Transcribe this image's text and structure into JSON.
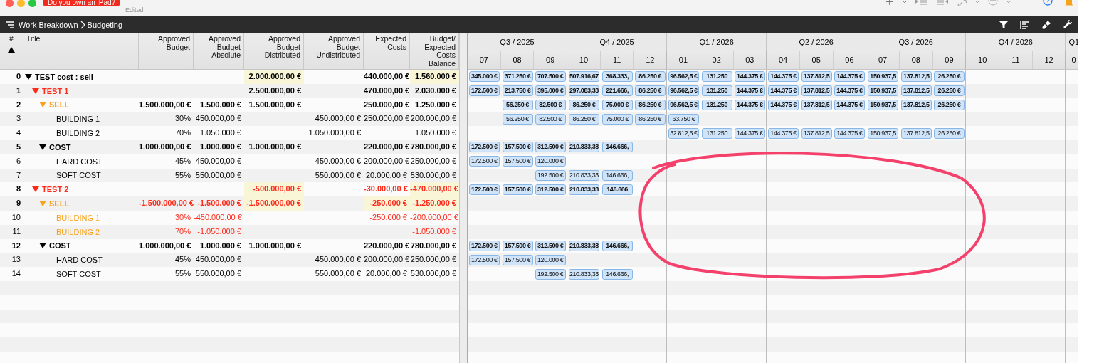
{
  "titlebar": {
    "badge": "Do you own an iPad?",
    "status": "Edited"
  },
  "breadcrumb": [
    "Work Breakdown",
    "Budgeting"
  ],
  "columns": [
    "#",
    "Title",
    "Approved Budget",
    "Approved Budget Absolute",
    "Approved Budget Distributed",
    "Approved Budget Undistributed",
    "Expected Costs",
    "Budget/ Expected Costs Balance"
  ],
  "timeline": {
    "quarters": [
      {
        "label": "Q3 / 2025",
        "months": [
          "07",
          "08",
          "09"
        ]
      },
      {
        "label": "Q4 / 2025",
        "months": [
          "10",
          "11",
          "12"
        ]
      },
      {
        "label": "Q1 / 2026",
        "months": [
          "01",
          "02",
          "03"
        ]
      },
      {
        "label": "Q2 / 2026",
        "months": [
          "04",
          "05",
          "06"
        ]
      },
      {
        "label": "Q3 / 2026",
        "months": [
          "07",
          "08",
          "09"
        ]
      },
      {
        "label": "Q4 / 2026",
        "months": [
          "10",
          "11",
          "12"
        ]
      },
      {
        "label": "Q1",
        "months": [
          "0"
        ]
      }
    ]
  },
  "rows": [
    {
      "number": "0",
      "title": "TEST cost : sell",
      "color": "#000000",
      "expanded": true,
      "negative": false,
      "approved_budget_distributed": {
        "text": "2.000.000,00 €",
        "highlighted": true
      },
      "expected_costs": {
        "text": "440.000,00 €",
        "highlighted": false
      },
      "balance": {
        "text": "1.560.000 €",
        "highlighted": true
      },
      "bars": [
        {
          "kind": "amount",
          "text": "345.000 €"
        },
        {
          "kind": "amount",
          "text": "371.250 €"
        },
        {
          "kind": "amount",
          "text": "707.500 €"
        },
        {
          "kind": "amount",
          "text": "507.916,67"
        },
        {
          "kind": "amount",
          "text": "368.333,"
        },
        {
          "kind": "amount",
          "text": "86.250 €"
        },
        {
          "kind": "amount",
          "text": "96.562,5 €"
        },
        {
          "kind": "amount",
          "text": "131.250"
        },
        {
          "kind": "amount",
          "text": "144.375 €"
        },
        {
          "kind": "amount",
          "text": "144.375 €"
        },
        {
          "kind": "amount",
          "text": "137.812,5"
        },
        {
          "kind": "amount",
          "text": "144.375 €"
        },
        {
          "kind": "amount",
          "text": "150.937,5"
        },
        {
          "kind": "amount",
          "text": "137.812,5"
        },
        {
          "kind": "amount",
          "text": "26.250 €"
        }
      ],
      "children": [
        {
          "number": "1",
          "title": "TEST 1",
          "color": "#ff2a1a",
          "expanded": true,
          "negative": false,
          "approved_budget_distributed": {
            "text": "2.500.000,00 €",
            "highlighted": false
          },
          "expected_costs": {
            "text": "470.000,00 €",
            "highlighted": false
          },
          "balance": {
            "text": "2.030.000 €",
            "highlighted": false
          },
          "bars": [
            {
              "kind": "amount",
              "text": "172.500 €"
            },
            {
              "kind": "amount",
              "text": "213.750 €"
            },
            {
              "kind": "amount",
              "text": "395.000 €"
            },
            {
              "kind": "amount",
              "text": "297.083,33"
            },
            {
              "kind": "amount",
              "text": "221.666,"
            },
            {
              "kind": "amount",
              "text": "86.250 €"
            },
            {
              "kind": "amount",
              "text": "96.562,5 €"
            },
            {
              "kind": "amount",
              "text": "131.250"
            },
            {
              "kind": "amount",
              "text": "144.375 €"
            },
            {
              "kind": "amount",
              "text": "144.375 €"
            },
            {
              "kind": "amount",
              "text": "137.812,5"
            },
            {
              "kind": "amount",
              "text": "144.375 €"
            },
            {
              "kind": "amount",
              "text": "150.937,5"
            },
            {
              "kind": "amount",
              "text": "137.812,5"
            },
            {
              "kind": "amount",
              "text": "26.250 €"
            }
          ],
          "children": [
            {
              "number": "2",
              "title": "SELL",
              "color": "#f9a11b",
              "expanded": true,
              "negative": false,
              "approved_budget": {
                "text": "1.500.000,00 €",
                "highlighted": false
              },
              "approved_budget_absolute": {
                "text": "1.500.000 €",
                "highlighted": false
              },
              "approved_budget_distributed": {
                "text": "1.500.000,00 €",
                "highlighted": false
              },
              "expected_costs": {
                "text": "250.000,00 €",
                "highlighted": false
              },
              "balance": {
                "text": "1.250.000 €",
                "highlighted": false
              },
              "bars": [
                {
                  "kind": "gap"
                },
                {
                  "kind": "amount",
                  "text": "56.250 €"
                },
                {
                  "kind": "amount",
                  "text": "82.500 €"
                },
                {
                  "kind": "amount",
                  "text": "86.250 €"
                },
                {
                  "kind": "amount",
                  "text": "75.000 €"
                },
                {
                  "kind": "amount",
                  "text": "86.250 €"
                },
                {
                  "kind": "amount",
                  "text": "96.562,5 €"
                },
                {
                  "kind": "amount",
                  "text": "131.250"
                },
                {
                  "kind": "amount",
                  "text": "144.375 €"
                },
                {
                  "kind": "amount",
                  "text": "144.375 €"
                },
                {
                  "kind": "amount",
                  "text": "137.812,5"
                },
                {
                  "kind": "amount",
                  "text": "144.375 €"
                },
                {
                  "kind": "amount",
                  "text": "150.937,5"
                },
                {
                  "kind": "amount",
                  "text": "137.812,5"
                },
                {
                  "kind": "amount",
                  "text": "26.250 €"
                }
              ],
              "children": [
                {
                  "number": "3",
                  "title": "BUILDING 1",
                  "color": "#000000",
                  "negative": false,
                  "approved_budget": {
                    "text": "30%",
                    "highlighted": false
                  },
                  "approved_budget_absolute": {
                    "text": "450.000,00 €",
                    "highlighted": false
                  },
                  "approved_budget_undistributed": {
                    "text": "450.000,00 €",
                    "highlighted": false
                  },
                  "expected_costs": {
                    "text": "250.000,00 €",
                    "highlighted": false
                  },
                  "balance": {
                    "text": "200.000,00 €",
                    "highlighted": false
                  },
                  "bars": [
                    {
                      "kind": "gap"
                    },
                    {
                      "kind": "amount",
                      "text": "56.250 €"
                    },
                    {
                      "kind": "amount",
                      "text": "82.500 €"
                    },
                    {
                      "kind": "amount",
                      "text": "86.250 €"
                    },
                    {
                      "kind": "amount",
                      "text": "75.000 €"
                    },
                    {
                      "kind": "amount",
                      "text": "86.250 €"
                    },
                    {
                      "kind": "amount",
                      "text": "63.750 €"
                    }
                  ]
                },
                {
                  "number": "4",
                  "title": "BUILDING 2",
                  "color": "#000000",
                  "negative": false,
                  "approved_budget": {
                    "text": "70%",
                    "highlighted": false
                  },
                  "approved_budget_absolute": {
                    "text": "1.050.000 €",
                    "highlighted": false
                  },
                  "approved_budget_undistributed": {
                    "text": "1.050.000,00 €",
                    "highlighted": false
                  },
                  "balance": {
                    "text": "1.050.000 €",
                    "highlighted": false
                  },
                  "bars": [
                    {
                      "kind": "gap"
                    },
                    {
                      "kind": "gap"
                    },
                    {
                      "kind": "gap"
                    },
                    {
                      "kind": "gap"
                    },
                    {
                      "kind": "gap"
                    },
                    {
                      "kind": "gap"
                    },
                    {
                      "kind": "amount",
                      "text": "32.812,5 €"
                    },
                    {
                      "kind": "amount",
                      "text": "131.250"
                    },
                    {
                      "kind": "amount",
                      "text": "144.375 €"
                    },
                    {
                      "kind": "amount",
                      "text": "144.375 €"
                    },
                    {
                      "kind": "amount",
                      "text": "137.812,5"
                    },
                    {
                      "kind": "amount",
                      "text": "144.375 €"
                    },
                    {
                      "kind": "amount",
                      "text": "150.937,5"
                    },
                    {
                      "kind": "amount",
                      "text": "137.812,5"
                    },
                    {
                      "kind": "amount",
                      "text": "26.250 €"
                    }
                  ]
                }
              ]
            },
            {
              "number": "5",
              "title": "COST",
              "color": "#000000",
              "expanded": true,
              "negative": false,
              "approved_budget": {
                "text": "1.000.000,00 €",
                "highlighted": false
              },
              "approved_budget_absolute": {
                "text": "1.000.000 €",
                "highlighted": false
              },
              "approved_budget_distributed": {
                "text": "1.000.000,00 €",
                "highlighted": false
              },
              "expected_costs": {
                "text": "220.000,00 €",
                "highlighted": false
              },
              "balance": {
                "text": "780.000,00 €",
                "highlighted": false
              },
              "bars": [
                {
                  "kind": "amount",
                  "text": "172.500 €"
                },
                {
                  "kind": "amount",
                  "text": "157.500 €"
                },
                {
                  "kind": "amount",
                  "text": "312.500 €"
                },
                {
                  "kind": "amount",
                  "text": "210.833,33"
                },
                {
                  "kind": "amount",
                  "text": "146.666,"
                }
              ],
              "children": [
                {
                  "number": "6",
                  "title": "HARD COST",
                  "color": "#000000",
                  "negative": false,
                  "approved_budget": {
                    "text": "45%",
                    "highlighted": false
                  },
                  "approved_budget_absolute": {
                    "text": "450.000,00 €",
                    "highlighted": false
                  },
                  "approved_budget_undistributed": {
                    "text": "450.000,00 €",
                    "highlighted": false
                  },
                  "expected_costs": {
                    "text": "200.000,00 €",
                    "highlighted": false
                  },
                  "balance": {
                    "text": "250.000,00 €",
                    "highlighted": false
                  },
                  "bars": [
                    {
                      "kind": "amount",
                      "text": "172.500 €"
                    },
                    {
                      "kind": "amount",
                      "text": "157.500 €"
                    },
                    {
                      "kind": "amount",
                      "text": "120.000 €"
                    }
                  ]
                },
                {
                  "number": "7",
                  "title": "SOFT COST",
                  "color": "#000000",
                  "negative": false,
                  "approved_budget": {
                    "text": "55%",
                    "highlighted": false
                  },
                  "approved_budget_absolute": {
                    "text": "550.000,00 €",
                    "highlighted": false
                  },
                  "approved_budget_undistributed": {
                    "text": "550.000,00 €",
                    "highlighted": false
                  },
                  "expected_costs": {
                    "text": "20.000,00 €",
                    "highlighted": false
                  },
                  "balance": {
                    "text": "530.000,00 €",
                    "highlighted": false
                  },
                  "bars": [
                    {
                      "kind": "gap"
                    },
                    {
                      "kind": "gap"
                    },
                    {
                      "kind": "amount",
                      "text": "192.500 €"
                    },
                    {
                      "kind": "amount",
                      "text": "210.833,33"
                    },
                    {
                      "kind": "amount",
                      "text": "146.666,"
                    }
                  ]
                }
              ]
            }
          ]
        },
        {
          "number": "8",
          "title": "TEST 2",
          "color": "#ff2a1a",
          "expanded": true,
          "negative": true,
          "approved_budget_distributed": {
            "text": "-500.000,00 €",
            "highlighted": true
          },
          "expected_costs": {
            "text": "-30.000,00 €",
            "highlighted": false
          },
          "balance": {
            "text": "-470.000,00 €",
            "highlighted": true
          },
          "bars": [
            {
              "kind": "amount",
              "text": "172.500 €"
            },
            {
              "kind": "amount",
              "text": "157.500 €"
            },
            {
              "kind": "amount",
              "text": "312.500 €"
            },
            {
              "kind": "amount",
              "text": "210.833,33"
            },
            {
              "kind": "amount",
              "text": "146.666"
            }
          ],
          "children": [
            {
              "number": "9",
              "title": "SELL",
              "color": "#f9a11b",
              "expanded": true,
              "negative": true,
              "approved_budget": {
                "text": "-1.500.000,00 €",
                "highlighted": false
              },
              "approved_budget_absolute": {
                "text": "-1.500.000 €",
                "highlighted": false
              },
              "approved_budget_distributed": {
                "text": "-1.500.000,00 €",
                "highlighted": true
              },
              "expected_costs": {
                "text": "-250.000 €",
                "highlighted": true
              },
              "balance": {
                "text": "-1.250.000 €",
                "highlighted": true
              },
              "children": [
                {
                  "number": "10",
                  "title": "BUILDING 1",
                  "color": "#f9a11b",
                  "negative": true,
                  "approved_budget": {
                    "text": "30%",
                    "highlighted": false
                  },
                  "approved_budget_absolute": {
                    "text": "-450.000,00 €",
                    "highlighted": false
                  },
                  "expected_costs": {
                    "text": "-250.000 €",
                    "highlighted": false
                  },
                  "balance": {
                    "text": "-200.000,00 €",
                    "highlighted": false
                  }
                },
                {
                  "number": "11",
                  "title": "BUILDING 2",
                  "color": "#f9a11b",
                  "negative": true,
                  "approved_budget": {
                    "text": "70%",
                    "highlighted": false
                  },
                  "approved_budget_absolute": {
                    "text": "-1.050.000 €",
                    "highlighted": false
                  },
                  "balance": {
                    "text": "-1.050.000 €",
                    "highlighted": false
                  }
                }
              ]
            },
            {
              "number": "12",
              "title": "COST",
              "color": "#000000",
              "expanded": true,
              "negative": false,
              "approved_budget": {
                "text": "1.000.000,00 €",
                "highlighted": false
              },
              "approved_budget_absolute": {
                "text": "1.000.000 €",
                "highlighted": false
              },
              "approved_budget_distributed": {
                "text": "1.000.000,00 €",
                "highlighted": false
              },
              "expected_costs": {
                "text": "220.000,00 €",
                "highlighted": false
              },
              "balance": {
                "text": "780.000,00 €",
                "highlighted": false
              },
              "bars": [
                {
                  "kind": "amount",
                  "text": "172.500 €"
                },
                {
                  "kind": "amount",
                  "text": "157.500 €"
                },
                {
                  "kind": "amount",
                  "text": "312.500 €"
                },
                {
                  "kind": "amount",
                  "text": "210.833,33"
                },
                {
                  "kind": "amount",
                  "text": "146.666,"
                }
              ],
              "children": [
                {
                  "number": "13",
                  "title": "HARD COST",
                  "color": "#000000",
                  "negative": false,
                  "approved_budget": {
                    "text": "45%",
                    "highlighted": false
                  },
                  "approved_budget_absolute": {
                    "text": "450.000,00 €",
                    "highlighted": false
                  },
                  "approved_budget_undistributed": {
                    "text": "450.000,00 €",
                    "highlighted": false
                  },
                  "expected_costs": {
                    "text": "200.000,00 €",
                    "highlighted": false
                  },
                  "balance": {
                    "text": "250.000,00 €",
                    "highlighted": false
                  },
                  "bars": [
                    {
                      "kind": "amount",
                      "text": "172.500 €"
                    },
                    {
                      "kind": "amount",
                      "text": "157.500 €"
                    },
                    {
                      "kind": "amount",
                      "text": "120.000 €"
                    }
                  ]
                },
                {
                  "number": "14",
                  "title": "SOFT COST",
                  "color": "#000000",
                  "negative": false,
                  "approved_budget": {
                    "text": "55%",
                    "highlighted": false
                  },
                  "approved_budget_absolute": {
                    "text": "550.000,00 €",
                    "highlighted": false
                  },
                  "approved_budget_undistributed": {
                    "text": "550.000,00 €",
                    "highlighted": false
                  },
                  "expected_costs": {
                    "text": "20.000,00 €",
                    "highlighted": false
                  },
                  "balance": {
                    "text": "530.000,00 €",
                    "highlighted": false
                  },
                  "bars": [
                    {
                      "kind": "gap"
                    },
                    {
                      "kind": "gap"
                    },
                    {
                      "kind": "amount",
                      "text": "192.500 €"
                    },
                    {
                      "kind": "amount",
                      "text": "210.833,33"
                    },
                    {
                      "kind": "amount",
                      "text": "146.666,"
                    }
                  ]
                }
              ]
            }
          ]
        }
      ]
    }
  ]
}
